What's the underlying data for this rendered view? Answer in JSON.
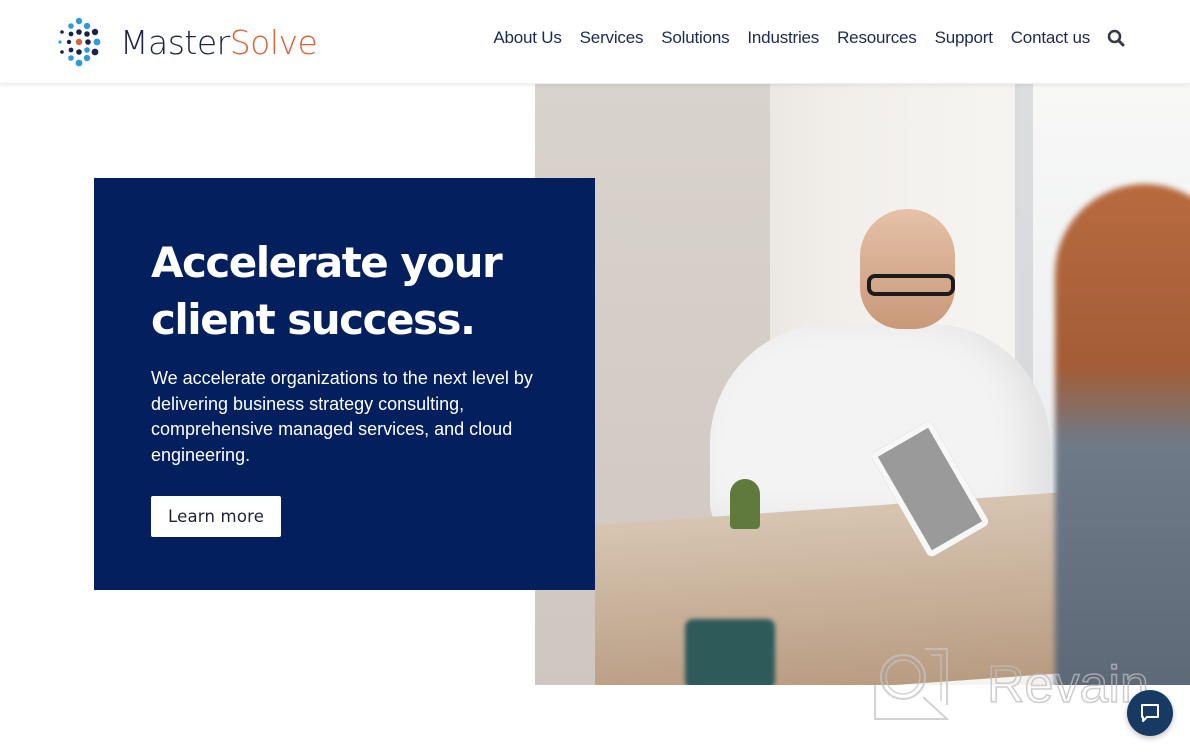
{
  "header": {
    "logo": {
      "part1": "Master",
      "part2": "Solve",
      "icon": "molecule-dots-logo-icon",
      "colors": {
        "dark": "#1b2448",
        "accent": "#d9633a",
        "light_blue": "#2f9ad8"
      }
    },
    "nav": [
      {
        "label": "About Us"
      },
      {
        "label": "Services"
      },
      {
        "label": "Solutions"
      },
      {
        "label": "Industries"
      },
      {
        "label": "Resources"
      },
      {
        "label": "Support"
      },
      {
        "label": "Contact us"
      }
    ],
    "search_icon": "search-icon"
  },
  "hero": {
    "title_line1": "Accelerate your",
    "title_line2": "client success.",
    "description": "We accelerate organizations to the next level by delivering business strategy consulting, comprehensive managed services, and cloud engineering.",
    "cta_label": "Learn more",
    "box_color": "#031f5e",
    "image": "team-meeting-photo"
  },
  "watermark": {
    "text": "Revain",
    "icon": "revain-logo-icon"
  },
  "chat": {
    "icon": "chat-bubble-icon",
    "color": "#173a63"
  }
}
